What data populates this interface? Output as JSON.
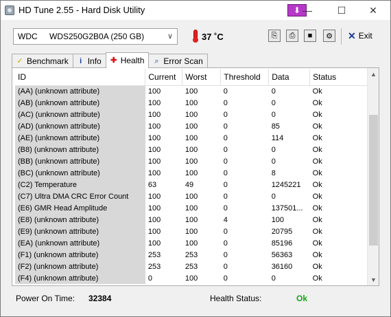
{
  "window": {
    "title": "HD Tune 2.55 - Hard Disk Utility",
    "controls": {
      "minimize": "—",
      "maximize": "☐",
      "close": "✕"
    }
  },
  "toolbar": {
    "drive_vendor": "WDC",
    "drive_model": "WDS250G2B0A (250 GB)",
    "temperature": "37 ˚C",
    "exit_label": "Exit",
    "icons": [
      "copy-text-icon",
      "copy-screenshot-icon",
      "save-icon",
      "options-icon"
    ]
  },
  "tabs": [
    {
      "label": "Benchmark",
      "icon": "benchmark-icon"
    },
    {
      "label": "Info",
      "icon": "info-icon"
    },
    {
      "label": "Health",
      "icon": "health-icon",
      "active": true
    },
    {
      "label": "Error Scan",
      "icon": "error-scan-icon"
    }
  ],
  "health_table": {
    "headers": [
      "ID",
      "Current",
      "Worst",
      "Threshold",
      "Data",
      "Status"
    ],
    "rows": [
      [
        "(AA) (unknown attribute)",
        "100",
        "100",
        "0",
        "0",
        "Ok"
      ],
      [
        "(AB) (unknown attribute)",
        "100",
        "100",
        "0",
        "0",
        "Ok"
      ],
      [
        "(AC) (unknown attribute)",
        "100",
        "100",
        "0",
        "0",
        "Ok"
      ],
      [
        "(AD) (unknown attribute)",
        "100",
        "100",
        "0",
        "85",
        "Ok"
      ],
      [
        "(AE) (unknown attribute)",
        "100",
        "100",
        "0",
        "114",
        "Ok"
      ],
      [
        "(B8) (unknown attribute)",
        "100",
        "100",
        "0",
        "0",
        "Ok"
      ],
      [
        "(BB) (unknown attribute)",
        "100",
        "100",
        "0",
        "0",
        "Ok"
      ],
      [
        "(BC) (unknown attribute)",
        "100",
        "100",
        "0",
        "8",
        "Ok"
      ],
      [
        "(C2) Temperature",
        "63",
        "49",
        "0",
        "1245221",
        "Ok"
      ],
      [
        "(C7) Ultra DMA CRC Error Count",
        "100",
        "100",
        "0",
        "0",
        "Ok"
      ],
      [
        "(E6) GMR Head Amplitude",
        "100",
        "100",
        "0",
        "137501...",
        "Ok"
      ],
      [
        "(E8) (unknown attribute)",
        "100",
        "100",
        "4",
        "100",
        "Ok"
      ],
      [
        "(E9) (unknown attribute)",
        "100",
        "100",
        "0",
        "20795",
        "Ok"
      ],
      [
        "(EA) (unknown attribute)",
        "100",
        "100",
        "0",
        "85196",
        "Ok"
      ],
      [
        "(F1) (unknown attribute)",
        "253",
        "253",
        "0",
        "56363",
        "Ok"
      ],
      [
        "(F2) (unknown attribute)",
        "253",
        "253",
        "0",
        "36160",
        "Ok"
      ],
      [
        "(F4) (unknown attribute)",
        "0",
        "100",
        "0",
        "0",
        "Ok"
      ]
    ],
    "scroll_position": 0.55
  },
  "status": {
    "power_on_label": "Power On Time:",
    "power_on_value": "32384",
    "health_label": "Health Status:",
    "health_value": "Ok",
    "health_color": "#12a812"
  }
}
